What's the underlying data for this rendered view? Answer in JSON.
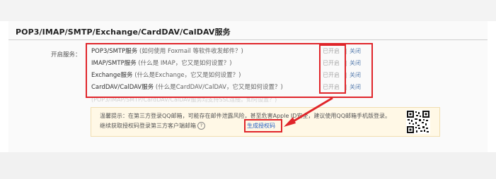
{
  "section": {
    "title": "POP3/IMAP/SMTP/Exchange/CardDAV/CalDAV服务"
  },
  "row_label": "开启服务：",
  "protocols": [
    {
      "name": "POP3/SMTP服务",
      "help": "(如何使用 Foxmail 等软件收发邮件？)",
      "on_label": "已开启",
      "sep": "|",
      "off_label": "关闭"
    },
    {
      "name": "IMAP/SMTP服务",
      "help": "(什么是 IMAP，它又是如何设置？)",
      "on_label": "已开启",
      "sep": "|",
      "off_label": "关闭"
    },
    {
      "name": "Exchange服务",
      "help": "(什么是Exchange，它又是如何设置？)",
      "on_label": "已开启",
      "sep": "|",
      "off_label": "关闭"
    },
    {
      "name": "CardDAV/CalDAV服务",
      "help": "(什么是CardDAV/CalDAV，它又是如何设置？)",
      "on_label": "已开启",
      "sep": "|",
      "off_label": "关闭"
    }
  ],
  "faded_note": "(POP3/IMAP/SMTP/CardDAV/CalDAV服务均支持SSL连接。如何设置？)",
  "tip": {
    "line1": "温馨提示：在第三方登录QQ邮箱，可能存在邮件泄露风险，甚至危害Apple ID安全，建议使用QQ邮箱手机版登录。",
    "line2": "继续获取授权码登录第三方客户端邮箱",
    "help_glyph": "?",
    "link": "生成授权码"
  },
  "colors": {
    "annotation": "#e0252a",
    "link": "#2a62c4"
  },
  "icons": {
    "qr": "qr-code-icon",
    "help": "help-circle-icon"
  }
}
